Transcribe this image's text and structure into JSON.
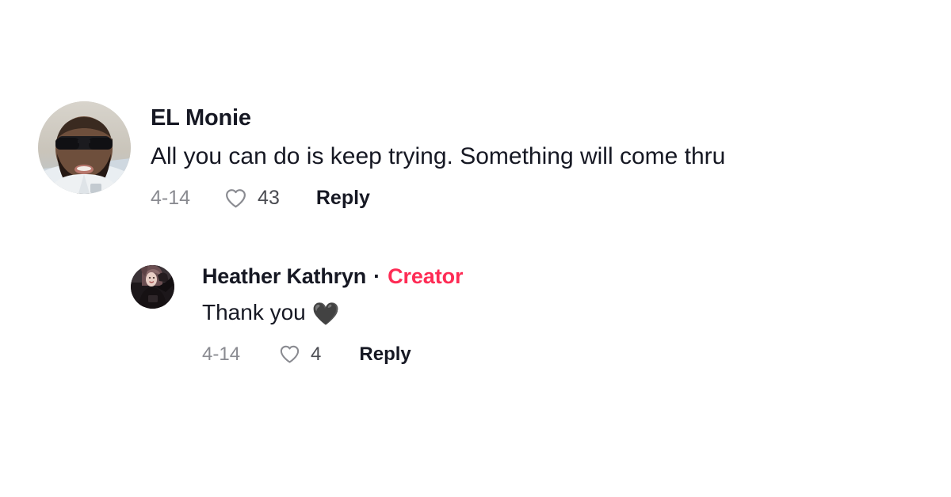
{
  "comment": {
    "author": "EL Monie",
    "avatar_alt": "man-with-sunglasses-and-beard-photo",
    "text": "All you can do is keep trying. Something will come thru",
    "date": "4-14",
    "like_count": "43",
    "reply_label": "Reply"
  },
  "reply": {
    "author": "Heather Kathryn",
    "separator": "·",
    "badge": "Creator",
    "avatar_alt": "woman-in-dark-clothing-photo",
    "text": "Thank you ",
    "emoji": "🖤",
    "date": "4-14",
    "like_count": "4",
    "reply_label": "Reply"
  },
  "colors": {
    "text_primary": "#161823",
    "text_muted": "#8a8b91",
    "creator_red": "#fe2c55",
    "background": "#ffffff"
  }
}
